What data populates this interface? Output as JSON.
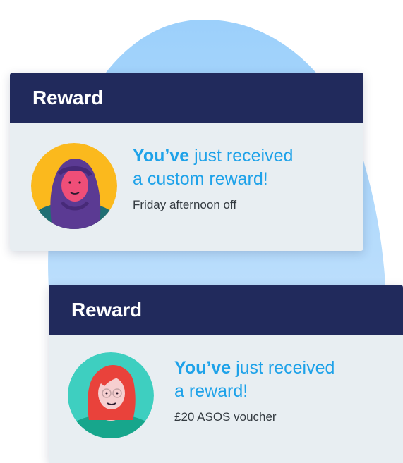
{
  "cards": [
    {
      "title": "Reward",
      "headline_bold": "You’ve",
      "headline_rest_line1": "just received",
      "headline_line2": "a custom reward!",
      "detail": "Friday afternoon off",
      "avatar_icon": "woman-hijab-avatar-icon",
      "avatar_bg": "#fbb91d"
    },
    {
      "title": "Reward",
      "headline_bold": "You’ve",
      "headline_rest_line1": "just received",
      "headline_line2": "a reward!",
      "detail": "£20 ASOS voucher",
      "avatar_icon": "woman-red-hair-avatar-icon",
      "avatar_bg": "#3ecfc0"
    }
  ],
  "colors": {
    "header_bg": "#212a5c",
    "card_bg": "#e8eef2",
    "accent": "#1ea2e9",
    "blob": "#a9d6fb"
  }
}
